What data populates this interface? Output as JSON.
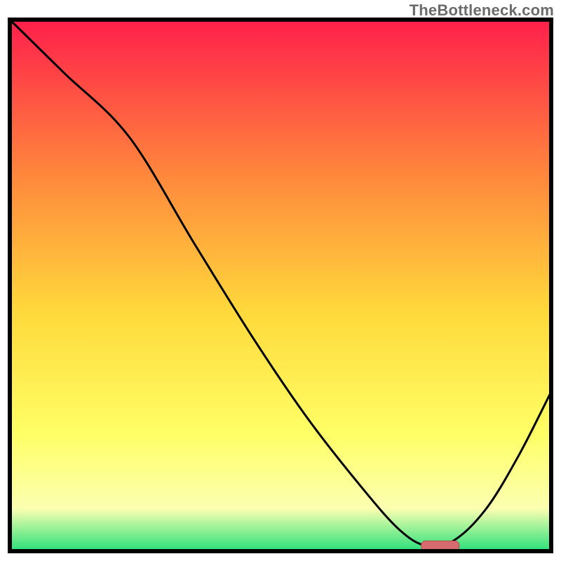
{
  "watermark": "TheBottleneck.com",
  "colors": {
    "frame": "#000000",
    "curve": "#000000",
    "marker_fill": "#d66b6f",
    "marker_stroke": "#b94a4e",
    "grad_top": "#ff1f4b",
    "grad_mid1": "#ff8a3c",
    "grad_mid2": "#ffd93b",
    "grad_mid3": "#ffff66",
    "grad_mid4": "#fbffb0",
    "grad_bottom": "#28e07a"
  },
  "chart_data": {
    "type": "line",
    "title": "",
    "xlabel": "",
    "ylabel": "",
    "xlim": [
      0,
      100
    ],
    "ylim": [
      0,
      100
    ],
    "x": [
      0,
      10,
      22,
      34,
      45,
      55,
      65,
      72,
      77,
      82,
      88,
      94,
      100
    ],
    "values": [
      100,
      90,
      78,
      58,
      40,
      25,
      12,
      4,
      1,
      2,
      8,
      18,
      30
    ],
    "annotations": [
      {
        "kind": "marker",
        "x_range": [
          76,
          83
        ],
        "y": 1
      }
    ],
    "gradient_stops": [
      {
        "offset": 0.0,
        "key": "grad_top"
      },
      {
        "offset": 0.3,
        "key": "grad_mid1"
      },
      {
        "offset": 0.55,
        "key": "grad_mid2"
      },
      {
        "offset": 0.78,
        "key": "grad_mid3"
      },
      {
        "offset": 0.92,
        "key": "grad_mid4"
      },
      {
        "offset": 1.0,
        "key": "grad_bottom"
      }
    ]
  }
}
